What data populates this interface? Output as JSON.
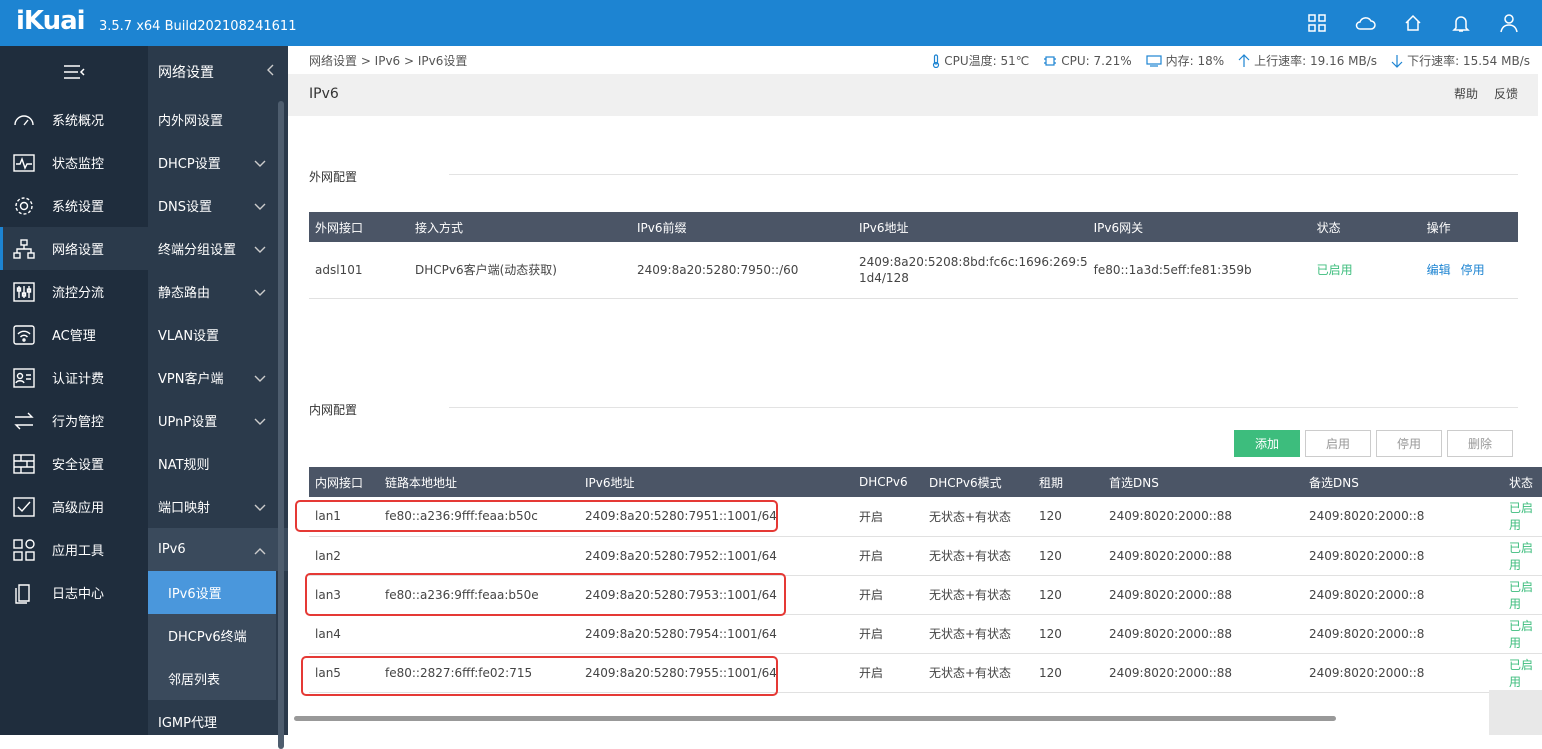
{
  "header": {
    "logo": "iKuai",
    "version": "3.5.7 x64 Build202108241611"
  },
  "sidebar": {
    "items": [
      {
        "label": "系统概况",
        "icon": "dashboard-icon"
      },
      {
        "label": "状态监控",
        "icon": "monitor-icon"
      },
      {
        "label": "系统设置",
        "icon": "gear-icon"
      },
      {
        "label": "网络设置",
        "icon": "network-icon"
      },
      {
        "label": "流控分流",
        "icon": "sliders-icon"
      },
      {
        "label": "AC管理",
        "icon": "wifi-icon"
      },
      {
        "label": "认证计费",
        "icon": "id-card-icon"
      },
      {
        "label": "行为管控",
        "icon": "arrows-icon"
      },
      {
        "label": "安全设置",
        "icon": "firewall-icon"
      },
      {
        "label": "高级应用",
        "icon": "checkbox-icon"
      },
      {
        "label": "应用工具",
        "icon": "apps-icon"
      },
      {
        "label": "日志中心",
        "icon": "document-icon"
      }
    ]
  },
  "subnav": {
    "title": "网络设置",
    "items": [
      {
        "label": "内外网设置",
        "chev": ""
      },
      {
        "label": "DHCP设置",
        "chev": "v"
      },
      {
        "label": "DNS设置",
        "chev": "v"
      },
      {
        "label": "终端分组设置",
        "chev": "v"
      },
      {
        "label": "静态路由",
        "chev": "v"
      },
      {
        "label": "VLAN设置",
        "chev": ""
      },
      {
        "label": "VPN客户端",
        "chev": "v"
      },
      {
        "label": "UPnP设置",
        "chev": "v"
      },
      {
        "label": "NAT规则",
        "chev": ""
      },
      {
        "label": "端口映射",
        "chev": "v"
      },
      {
        "label": "IPv6",
        "chev": "^"
      }
    ],
    "sub_items": [
      "IPv6设置",
      "DHCPv6终端",
      "邻居列表"
    ],
    "after": "IGMP代理"
  },
  "breadcrumb": "网络设置 > IPv6 > IPv6设置",
  "stats": {
    "cpu_temp": "CPU温度: 51℃",
    "cpu": "CPU: 7.21%",
    "mem": "内存: 18%",
    "up": "上行速率: 19.16 MB/s",
    "down": "下行速率: 15.54 MB/s"
  },
  "page": {
    "title": "IPv6",
    "help": "帮助",
    "feedback": "反馈",
    "wan_section": "外网配置",
    "lan_section": "内网配置"
  },
  "wan_table": {
    "headers": [
      "外网接口",
      "接入方式",
      "IPv6前缀",
      "IPv6地址",
      "IPv6网关",
      "状态",
      "操作"
    ],
    "row": {
      "iface": "adsl101",
      "mode": "DHCPv6客户端(动态获取)",
      "prefix": "2409:8a20:5280:7950::/60",
      "addr1": "2409:8a20:5208:8bd:fc6c:1696:269:5",
      "addr2": "1d4/128",
      "gateway": "fe80::1a3d:5eff:fe81:359b",
      "status": "已启用",
      "edit": "编辑",
      "disable": "停用"
    }
  },
  "buttons": {
    "add": "添加",
    "enable": "启用",
    "disable": "停用",
    "delete": "删除"
  },
  "lan_table": {
    "headers": [
      "内网接口",
      "链路本地地址",
      "IPv6地址",
      "DHCPv6",
      "DHCPv6模式",
      "租期",
      "首选DNS",
      "备选DNS",
      "状态"
    ],
    "rows": [
      {
        "iface": "lan1",
        "link": "fe80::a236:9fff:feaa:b50c",
        "addr": "2409:8a20:5280:7951::1001/64",
        "dhcp": "开启",
        "mode": "无状态+有状态",
        "lease": "120",
        "dns1": "2409:8020:2000::88",
        "dns2": "2409:8020:2000::8",
        "status": "已启用"
      },
      {
        "iface": "lan2",
        "link": "",
        "addr": "2409:8a20:5280:7952::1001/64",
        "dhcp": "开启",
        "mode": "无状态+有状态",
        "lease": "120",
        "dns1": "2409:8020:2000::88",
        "dns2": "2409:8020:2000::8",
        "status": "已启用"
      },
      {
        "iface": "lan3",
        "link": "fe80::a236:9fff:feaa:b50e",
        "addr": "2409:8a20:5280:7953::1001/64",
        "dhcp": "开启",
        "mode": "无状态+有状态",
        "lease": "120",
        "dns1": "2409:8020:2000::88",
        "dns2": "2409:8020:2000::8",
        "status": "已启用"
      },
      {
        "iface": "lan4",
        "link": "",
        "addr": "2409:8a20:5280:7954::1001/64",
        "dhcp": "开启",
        "mode": "无状态+有状态",
        "lease": "120",
        "dns1": "2409:8020:2000::88",
        "dns2": "2409:8020:2000::8",
        "status": "已启用"
      },
      {
        "iface": "lan5",
        "link": "fe80::2827:6fff:fe02:715",
        "addr": "2409:8a20:5280:7955::1001/64",
        "dhcp": "开启",
        "mode": "无状态+有状态",
        "lease": "120",
        "dns1": "2409:8020:2000::88",
        "dns2": "2409:8020:2000::8",
        "status": "已启用"
      }
    ]
  },
  "colors": {
    "brand": "#1d84d2",
    "sidebar": "#1f2d3d",
    "submenu": "#2b3a4b",
    "active_sub": "#4a97dc",
    "green": "#3dbd7d",
    "highlight": "#e53935"
  }
}
